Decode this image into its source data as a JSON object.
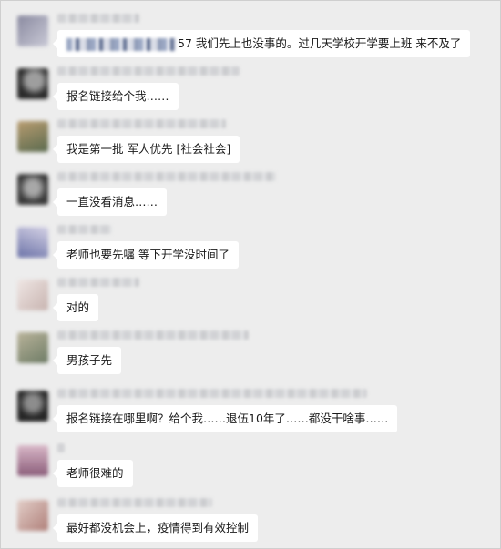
{
  "messages": [
    {
      "text": "57 我们先上也没事的。过几天学校开学要上班 来不及了",
      "avatar": "avatar-1",
      "colors": [
        "#8a8aa0",
        "#c9c9d6"
      ]
    },
    {
      "text": "报名链接给个我……",
      "avatar": "avatar-2",
      "colors": [
        "#2b2b2b",
        "#9e9e9e"
      ]
    },
    {
      "text": "我是第一批 军人优先 [社会社会]",
      "avatar": "avatar-3",
      "colors": [
        "#5a6a4e",
        "#b89c70"
      ]
    },
    {
      "text": "一直没看消息……",
      "avatar": "avatar-4",
      "colors": [
        "#3a3a3a",
        "#a8a8a8"
      ]
    },
    {
      "text": "老师也要先嘱 等下开学没时间了",
      "avatar": "avatar-5",
      "colors": [
        "#6c73a8",
        "#d6d3e6"
      ]
    },
    {
      "text": "对的",
      "avatar": "avatar-6",
      "colors": [
        "#c8b4b0",
        "#efe6e4"
      ]
    },
    {
      "text": "男孩子先",
      "avatar": "avatar-7",
      "colors": [
        "#6e7c66",
        "#b9b39a"
      ]
    },
    {
      "text": "报名链接在哪里啊？给个我……退伍10年了……都没干啥事……",
      "avatar": "avatar-8",
      "colors": [
        "#262626",
        "#8d8d8d"
      ]
    },
    {
      "text": "老师很难的",
      "avatar": "avatar-9",
      "colors": [
        "#8b5d7a",
        "#d9b8c8"
      ]
    },
    {
      "text": "最好都没机会上，疫情得到有效控制",
      "avatar": "avatar-10",
      "colors": [
        "#b0807a",
        "#e3cfc9"
      ]
    }
  ]
}
